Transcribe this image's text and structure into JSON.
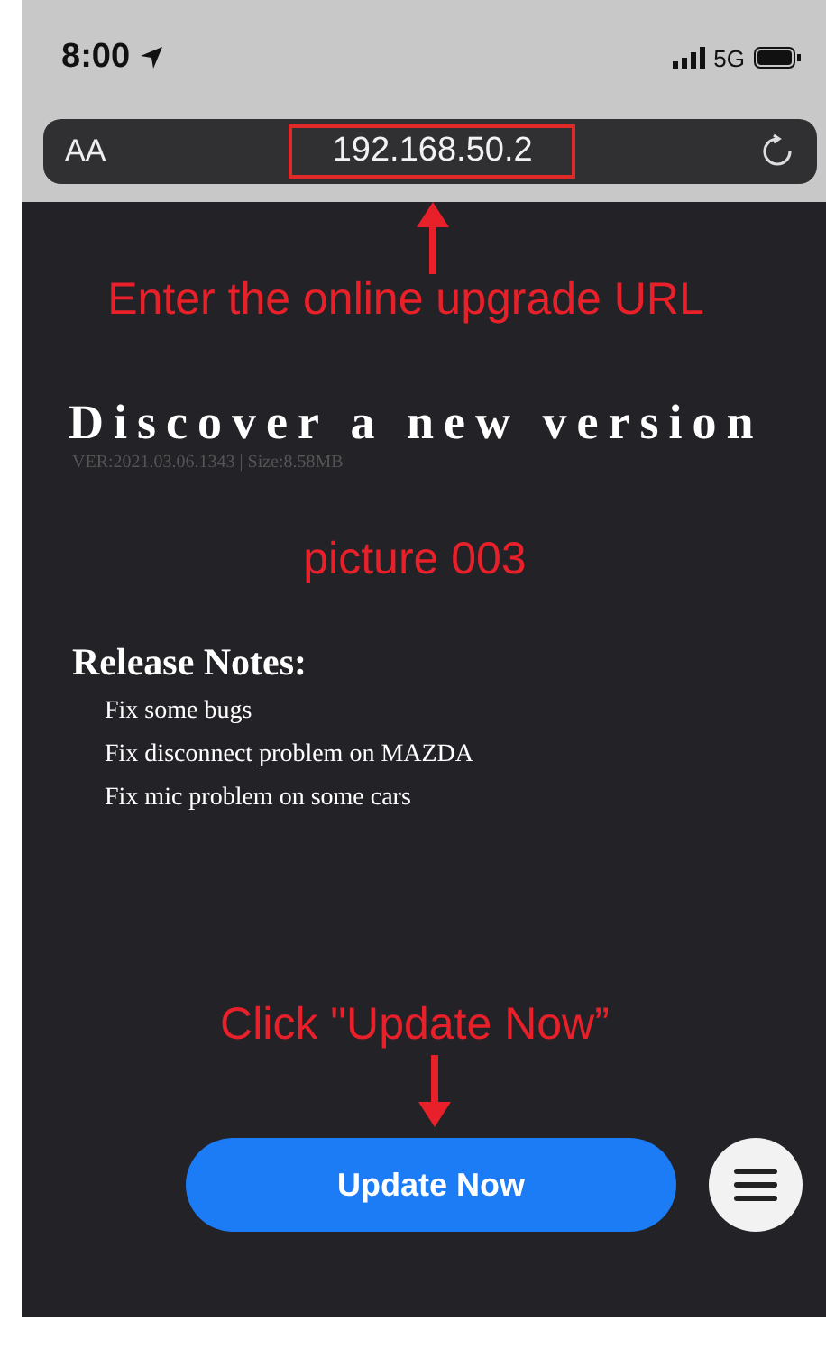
{
  "status_bar": {
    "time": "8:00",
    "network": "5G"
  },
  "address_bar": {
    "text_size_label": "AA",
    "url": "192.168.50.2",
    "url_highlighted": true
  },
  "annotations": {
    "url_hint": "Enter the online upgrade URL",
    "picture_label": "picture 003",
    "click_hint": "Click \"Update Now”"
  },
  "update": {
    "title": "Discover a new version",
    "version_info": "VER:2021.03.06.1343 | Size:8.58MB",
    "notes_heading": "Release Notes:",
    "notes": [
      "Fix some bugs",
      "Fix disconnect problem on MAZDA",
      "Fix mic problem on some cars"
    ],
    "button": "Update Now"
  }
}
